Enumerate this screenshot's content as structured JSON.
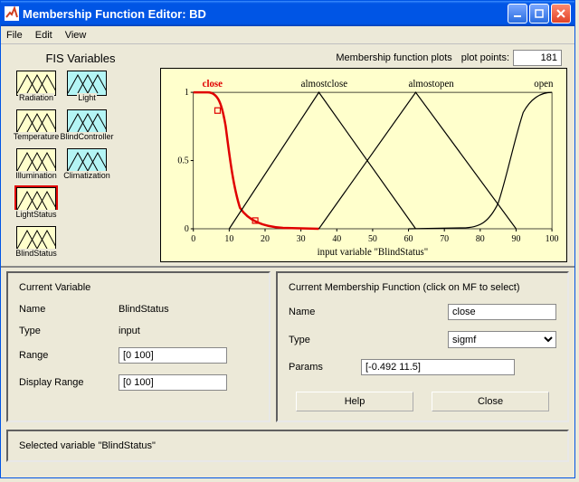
{
  "window": {
    "title": "Membership Function Editor: BD"
  },
  "menu": {
    "file": "File",
    "edit": "Edit",
    "view": "View"
  },
  "fis": {
    "title": "FIS Variables",
    "left": [
      {
        "label": "Radiation"
      },
      {
        "label": "Temperature"
      },
      {
        "label": "Illumination"
      },
      {
        "label": "LightStatus"
      },
      {
        "label": "BlindStatus"
      }
    ],
    "right": [
      {
        "label": "Light"
      },
      {
        "label": "BlindController"
      },
      {
        "label": "Climatization"
      }
    ]
  },
  "plot": {
    "mfp_label": "Membership function plots",
    "pp_label": "plot points:",
    "pp_value": "181",
    "xaxis_label": "input variable \"BlindStatus\"",
    "xticks": [
      "0",
      "10",
      "20",
      "30",
      "40",
      "50",
      "60",
      "70",
      "80",
      "90",
      "100"
    ],
    "yticks": [
      "0",
      "0.5",
      "1"
    ],
    "labels": {
      "close": "close",
      "almostclose": "almostclose",
      "almostopen": "almostopen",
      "open": "open"
    }
  },
  "chart_data": {
    "type": "line",
    "title": "Membership function plots",
    "xlabel": "input variable \"BlindStatus\"",
    "ylabel": "",
    "xlim": [
      0,
      100
    ],
    "ylim": [
      0,
      1
    ],
    "x": [
      0,
      5,
      10,
      15,
      20,
      25,
      30,
      35,
      40,
      45,
      50,
      55,
      60,
      65,
      70,
      75,
      80,
      85,
      90,
      95,
      100
    ],
    "series": [
      {
        "name": "close",
        "type": "sigmf",
        "params": [
          -0.492,
          11.5
        ],
        "values": [
          1.0,
          0.96,
          0.68,
          0.15,
          0.02,
          0.0,
          0.0,
          0.0,
          0.0,
          0.0,
          0.0,
          0.0,
          0.0,
          0.0,
          0.0,
          0.0,
          0.0,
          0.0,
          0.0,
          0.0,
          0.0
        ]
      },
      {
        "name": "almostclose",
        "type": "trimf",
        "params": [
          10,
          35,
          62
        ],
        "values": [
          0.0,
          0.0,
          0.0,
          0.2,
          0.4,
          0.6,
          0.8,
          1.0,
          0.81,
          0.63,
          0.44,
          0.26,
          0.07,
          0.0,
          0.0,
          0.0,
          0.0,
          0.0,
          0.0,
          0.0,
          0.0
        ]
      },
      {
        "name": "almostopen",
        "type": "trimf",
        "params": [
          35,
          62,
          90
        ],
        "values": [
          0.0,
          0.0,
          0.0,
          0.0,
          0.0,
          0.0,
          0.0,
          0.0,
          0.19,
          0.37,
          0.56,
          0.74,
          0.93,
          0.89,
          0.71,
          0.54,
          0.36,
          0.18,
          0.0,
          0.0,
          0.0
        ]
      },
      {
        "name": "open",
        "type": "sigmf",
        "params": [
          0.492,
          88.5
        ],
        "values": [
          0.0,
          0.0,
          0.0,
          0.0,
          0.0,
          0.0,
          0.0,
          0.0,
          0.0,
          0.0,
          0.0,
          0.0,
          0.0,
          0.0,
          0.0,
          0.0,
          0.04,
          0.15,
          0.68,
          0.96,
          1.0
        ]
      }
    ]
  },
  "curvar": {
    "title": "Current Variable",
    "name_label": "Name",
    "name_value": "BlindStatus",
    "type_label": "Type",
    "type_value": "input",
    "range_label": "Range",
    "range_value": "[0 100]",
    "disp_label": "Display Range",
    "disp_value": "[0 100]"
  },
  "curmf": {
    "title": "Current Membership Function (click on MF to select)",
    "name_label": "Name",
    "name_value": "close",
    "type_label": "Type",
    "type_value": "sigmf",
    "params_label": "Params",
    "params_value": "[-0.492 11.5]",
    "help_label": "Help",
    "close_label": "Close"
  },
  "status": {
    "text": "Selected variable \"BlindStatus\""
  }
}
